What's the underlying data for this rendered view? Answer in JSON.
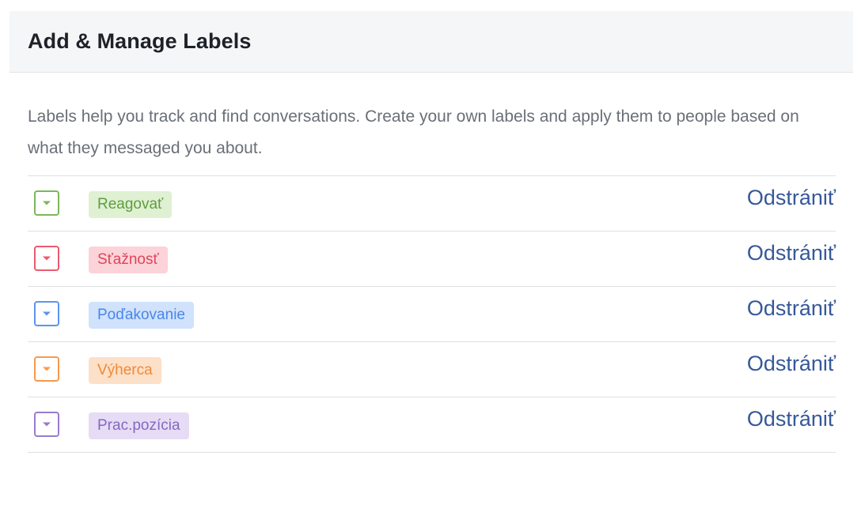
{
  "header": {
    "title": "Add & Manage Labels"
  },
  "description": "Labels help you track and find conversations. Create your own labels and apply them to people based on what they messaged you about.",
  "labels": [
    {
      "name": "Reagovať",
      "remove_label": "Odstrániť",
      "border_color": "#7cb65a",
      "chip_bg": "#dff0d3",
      "chip_text": "#5f9e3c"
    },
    {
      "name": "Sťažnosť",
      "remove_label": "Odstrániť",
      "border_color": "#ec5a6e",
      "chip_bg": "#fcd3d8",
      "chip_text": "#e0445b"
    },
    {
      "name": "Poďakovanie",
      "remove_label": "Odstrániť",
      "border_color": "#5b94f0",
      "chip_bg": "#d0e2fc",
      "chip_text": "#4a86e8"
    },
    {
      "name": "Výherca",
      "remove_label": "Odstrániť",
      "border_color": "#f59a4e",
      "chip_bg": "#fde0c8",
      "chip_text": "#ee8a38"
    },
    {
      "name": "Prac.pozícia",
      "remove_label": "Odstrániť",
      "border_color": "#9a7bd0",
      "chip_bg": "#e6dcf5",
      "chip_text": "#8468bf"
    }
  ],
  "icons": {
    "dropdown": "chevron-down-icon"
  }
}
